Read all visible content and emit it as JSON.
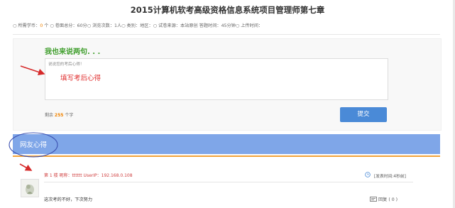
{
  "page": {
    "title": "2015计算机软考高级资格信息系统项目管理师第七章"
  },
  "meta": {
    "price_prefix": "○ 所需学币：",
    "price_value": "0",
    "price_suffix": " 个",
    "items_text": " ○ 卷面总分：60分○ 浏览次数：1人○ 类别：地区：○ 试卷来源：本站原创 答题时间：45分钟○ 上传时间："
  },
  "comment_form": {
    "heading": "我也来说两句. . .",
    "placeholder": "说说您的考后心得！",
    "annotation": "填写考后心得",
    "remaining_prefix": "剩余 ",
    "remaining_count": "255",
    "remaining_suffix": " 个字",
    "submit_label": "提交"
  },
  "reviews": {
    "tab_label": "网友心得",
    "items": [
      {
        "floor_info": "第 1 楼 昵称：tttttt UserIP：192.168.0.108",
        "post_time": "[发表时间:4秒前]",
        "text": "这次考的不好，下次努力",
        "reply_label": "回复 ( 0 )"
      }
    ]
  },
  "colors": {
    "accent_green": "#3f9e2c",
    "button_blue": "#4a8ad7",
    "tab_blue": "#7fa6e8",
    "orange": "#f08300",
    "annotation_red": "#e03030"
  }
}
